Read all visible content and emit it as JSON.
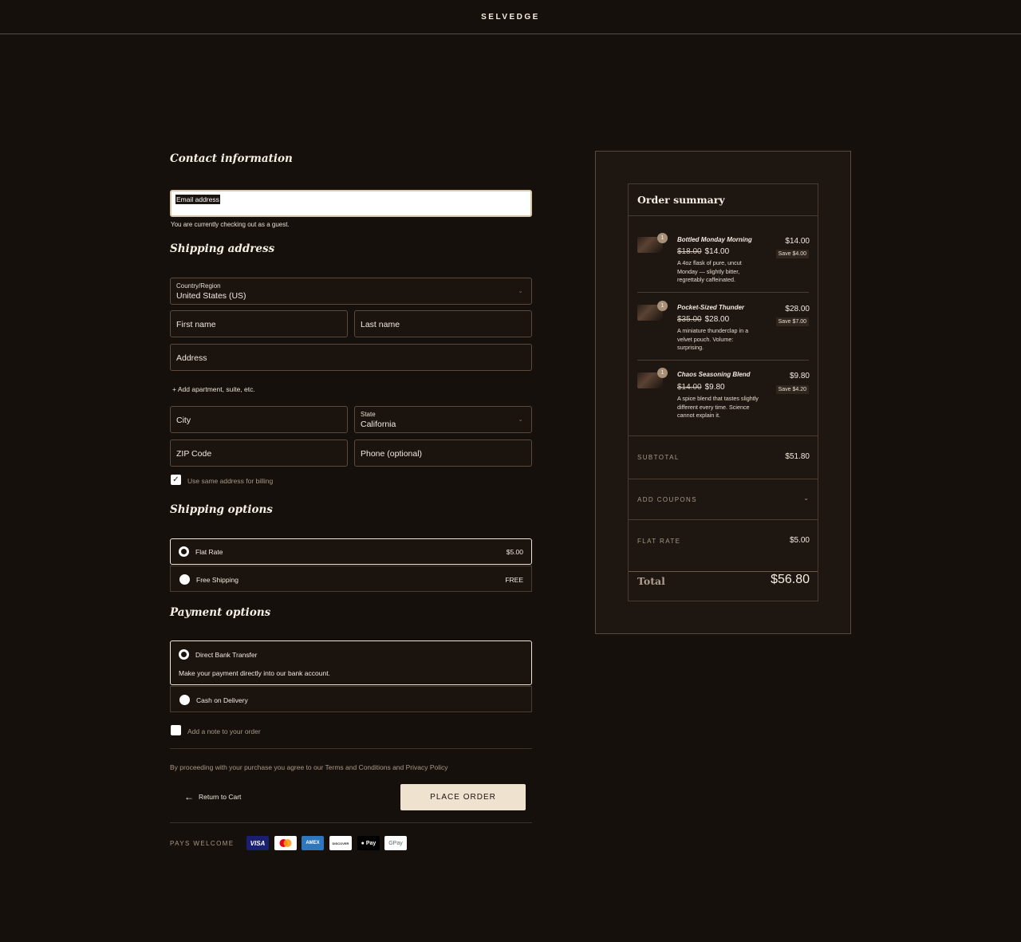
{
  "header": {
    "logo": "SELVEDGE"
  },
  "contact": {
    "heading": "Contact information",
    "email_placeholder": "Email address",
    "guest_note": "You are currently checking out as a guest."
  },
  "shipping_address": {
    "heading": "Shipping address",
    "country_label": "Country/Region",
    "country_value": "United States (US)",
    "first_name": "First name",
    "last_name": "Last name",
    "address": "Address",
    "add_apartment": "+ Add apartment, suite, etc.",
    "city": "City",
    "state_label": "State",
    "state_value": "California",
    "zip": "ZIP Code",
    "phone": "Phone (optional)",
    "same_billing_label": "Use same address for billing",
    "same_billing_checked": true
  },
  "shipping_options": {
    "heading": "Shipping options",
    "options": [
      {
        "label": "Flat Rate",
        "price": "$5.00",
        "selected": true
      },
      {
        "label": "Free Shipping",
        "price": "FREE",
        "selected": false
      }
    ]
  },
  "payment_options": {
    "heading": "Payment options",
    "options": [
      {
        "label": "Direct Bank Transfer",
        "description": "Make your payment directly into our bank account.",
        "selected": true
      },
      {
        "label": "Cash on Delivery",
        "selected": false
      }
    ],
    "add_note_label": "Add a note to your order"
  },
  "footer": {
    "terms": "By proceeding with your purchase you agree to our Terms and Conditions and Privacy Policy",
    "return_to_cart": "Return to Cart",
    "place_order": "PLACE ORDER",
    "pays_welcome": "PAYS WELCOME",
    "payment_icons": [
      {
        "name": "visa",
        "text": "VISA",
        "bg": "#1a1f71",
        "fg": "#ffffff"
      },
      {
        "name": "mastercard",
        "text": "",
        "bg": "#ffffff",
        "fg": "#eb001b"
      },
      {
        "name": "amex",
        "text": "AMEX",
        "bg": "#2e77bc",
        "fg": "#ffffff"
      },
      {
        "name": "discover",
        "text": "DISCOVER",
        "bg": "#ffffff",
        "fg": "#231f20"
      },
      {
        "name": "apple-pay",
        "text": "Pay",
        "bg": "#000000",
        "fg": "#ffffff"
      },
      {
        "name": "google-pay",
        "text": "GPay",
        "bg": "#ffffff",
        "fg": "#5f6368"
      }
    ]
  },
  "summary": {
    "heading": "Order summary",
    "items": [
      {
        "qty": "1",
        "name": "Bottled Monday Morning",
        "old_price": "$18.00",
        "price": "$14.00",
        "description": "A 4oz flask of pure, uncut Monday — slightly bitter, regrettably caffeinated.",
        "total": "$14.00",
        "save": "Save $4.00"
      },
      {
        "qty": "1",
        "name": "Pocket-Sized Thunder",
        "old_price": "$35.00",
        "price": "$28.00",
        "description": "A miniature thunderclap in a velvet pouch. Volume: surprising.",
        "total": "$28.00",
        "save": "Save $7.00"
      },
      {
        "qty": "1",
        "name": "Chaos Seasoning Blend",
        "old_price": "$14.00",
        "price": "$9.80",
        "description": "A spice blend that tastes slightly different every time. Science cannot explain it.",
        "total": "$9.80",
        "save": "Save $4.20"
      }
    ],
    "subtotal_label": "SUBTOTAL",
    "subtotal_value": "$51.80",
    "coupons_label": "ADD COUPONS",
    "flat_rate_label": "FLAT RATE",
    "flat_rate_value": "$5.00",
    "total_label": "Total",
    "total_value": "$56.80"
  }
}
